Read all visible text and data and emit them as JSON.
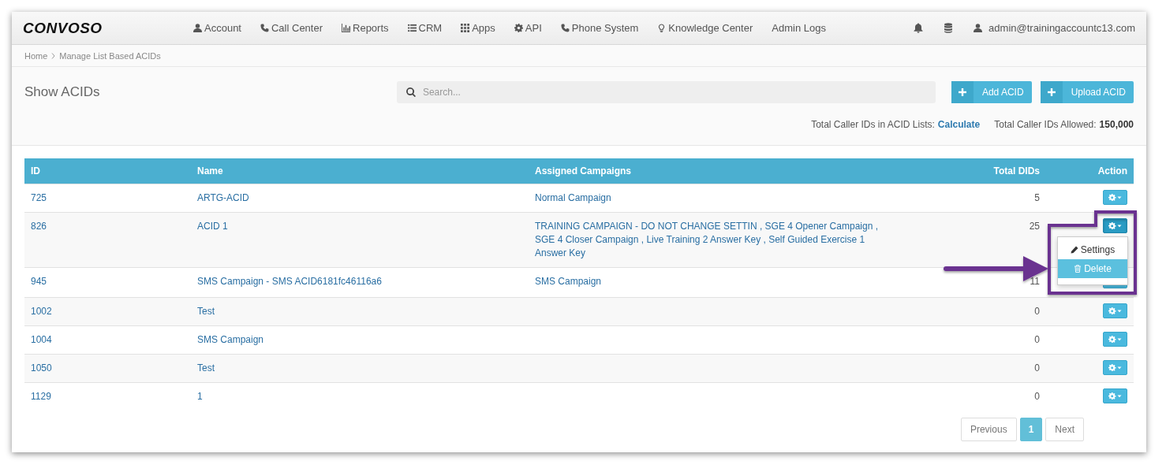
{
  "navbar": {
    "logo": "CONVOSO",
    "items": [
      "Account",
      "Call Center",
      "Reports",
      "CRM",
      "Apps",
      "API",
      "Phone System",
      "Knowledge Center",
      "Admin Logs"
    ],
    "user": "admin@trainingaccountc13.com"
  },
  "breadcrumb": [
    "Home",
    "Manage List Based ACIDs"
  ],
  "title": "Show ACIDs",
  "search": {
    "placeholder": "Search..."
  },
  "buttons": [
    "Add ACID",
    "Upload ACID"
  ],
  "stats": {
    "label_1": "Total Caller IDs in ACID Lists:",
    "link": "Calculate",
    "label_2": "Total Caller IDs Allowed:",
    "value": "150,000"
  },
  "table": {
    "columns": [
      "ID",
      "Name",
      "Assigned Campaigns",
      "Total DIDs",
      "Action"
    ],
    "rows": [
      {
        "id": "725",
        "name": "ARTG-ACID",
        "campaigns": "Normal Campaign",
        "total": "5",
        "menu_open": false
      },
      {
        "id": "826",
        "name": "ACID 1",
        "campaigns": "TRAINING CAMPAIGN - DO NOT CHANGE SETTIN , SGE 4 Opener Campaign , SGE 4 Closer Campaign , Live Training 2 Answer Key , Self Guided Exercise 1 Answer Key",
        "total": "25",
        "menu_open": true
      },
      {
        "id": "945",
        "name": "SMS Campaign - SMS ACID6181fc46116a6",
        "campaigns": "SMS Campaign",
        "total": "11",
        "menu_open": false
      },
      {
        "id": "1002",
        "name": "Test",
        "total": "0",
        "menu_open": false
      },
      {
        "id": "1004",
        "name": "SMS Campaign",
        "total": "0",
        "menu_open": false
      },
      {
        "id": "1050",
        "name": "Test",
        "total": "0",
        "menu_open": false
      },
      {
        "id": "1129",
        "name": "1",
        "total": "0",
        "menu_open": false
      }
    ]
  },
  "action_menu": [
    {
      "label": "Settings",
      "selected": false
    },
    {
      "label": "Delete",
      "selected": true
    }
  ],
  "pagination": [
    {
      "label": "Previous",
      "selected": false
    },
    {
      "label": "1",
      "selected": true
    },
    {
      "label": "Next",
      "selected": false
    }
  ]
}
